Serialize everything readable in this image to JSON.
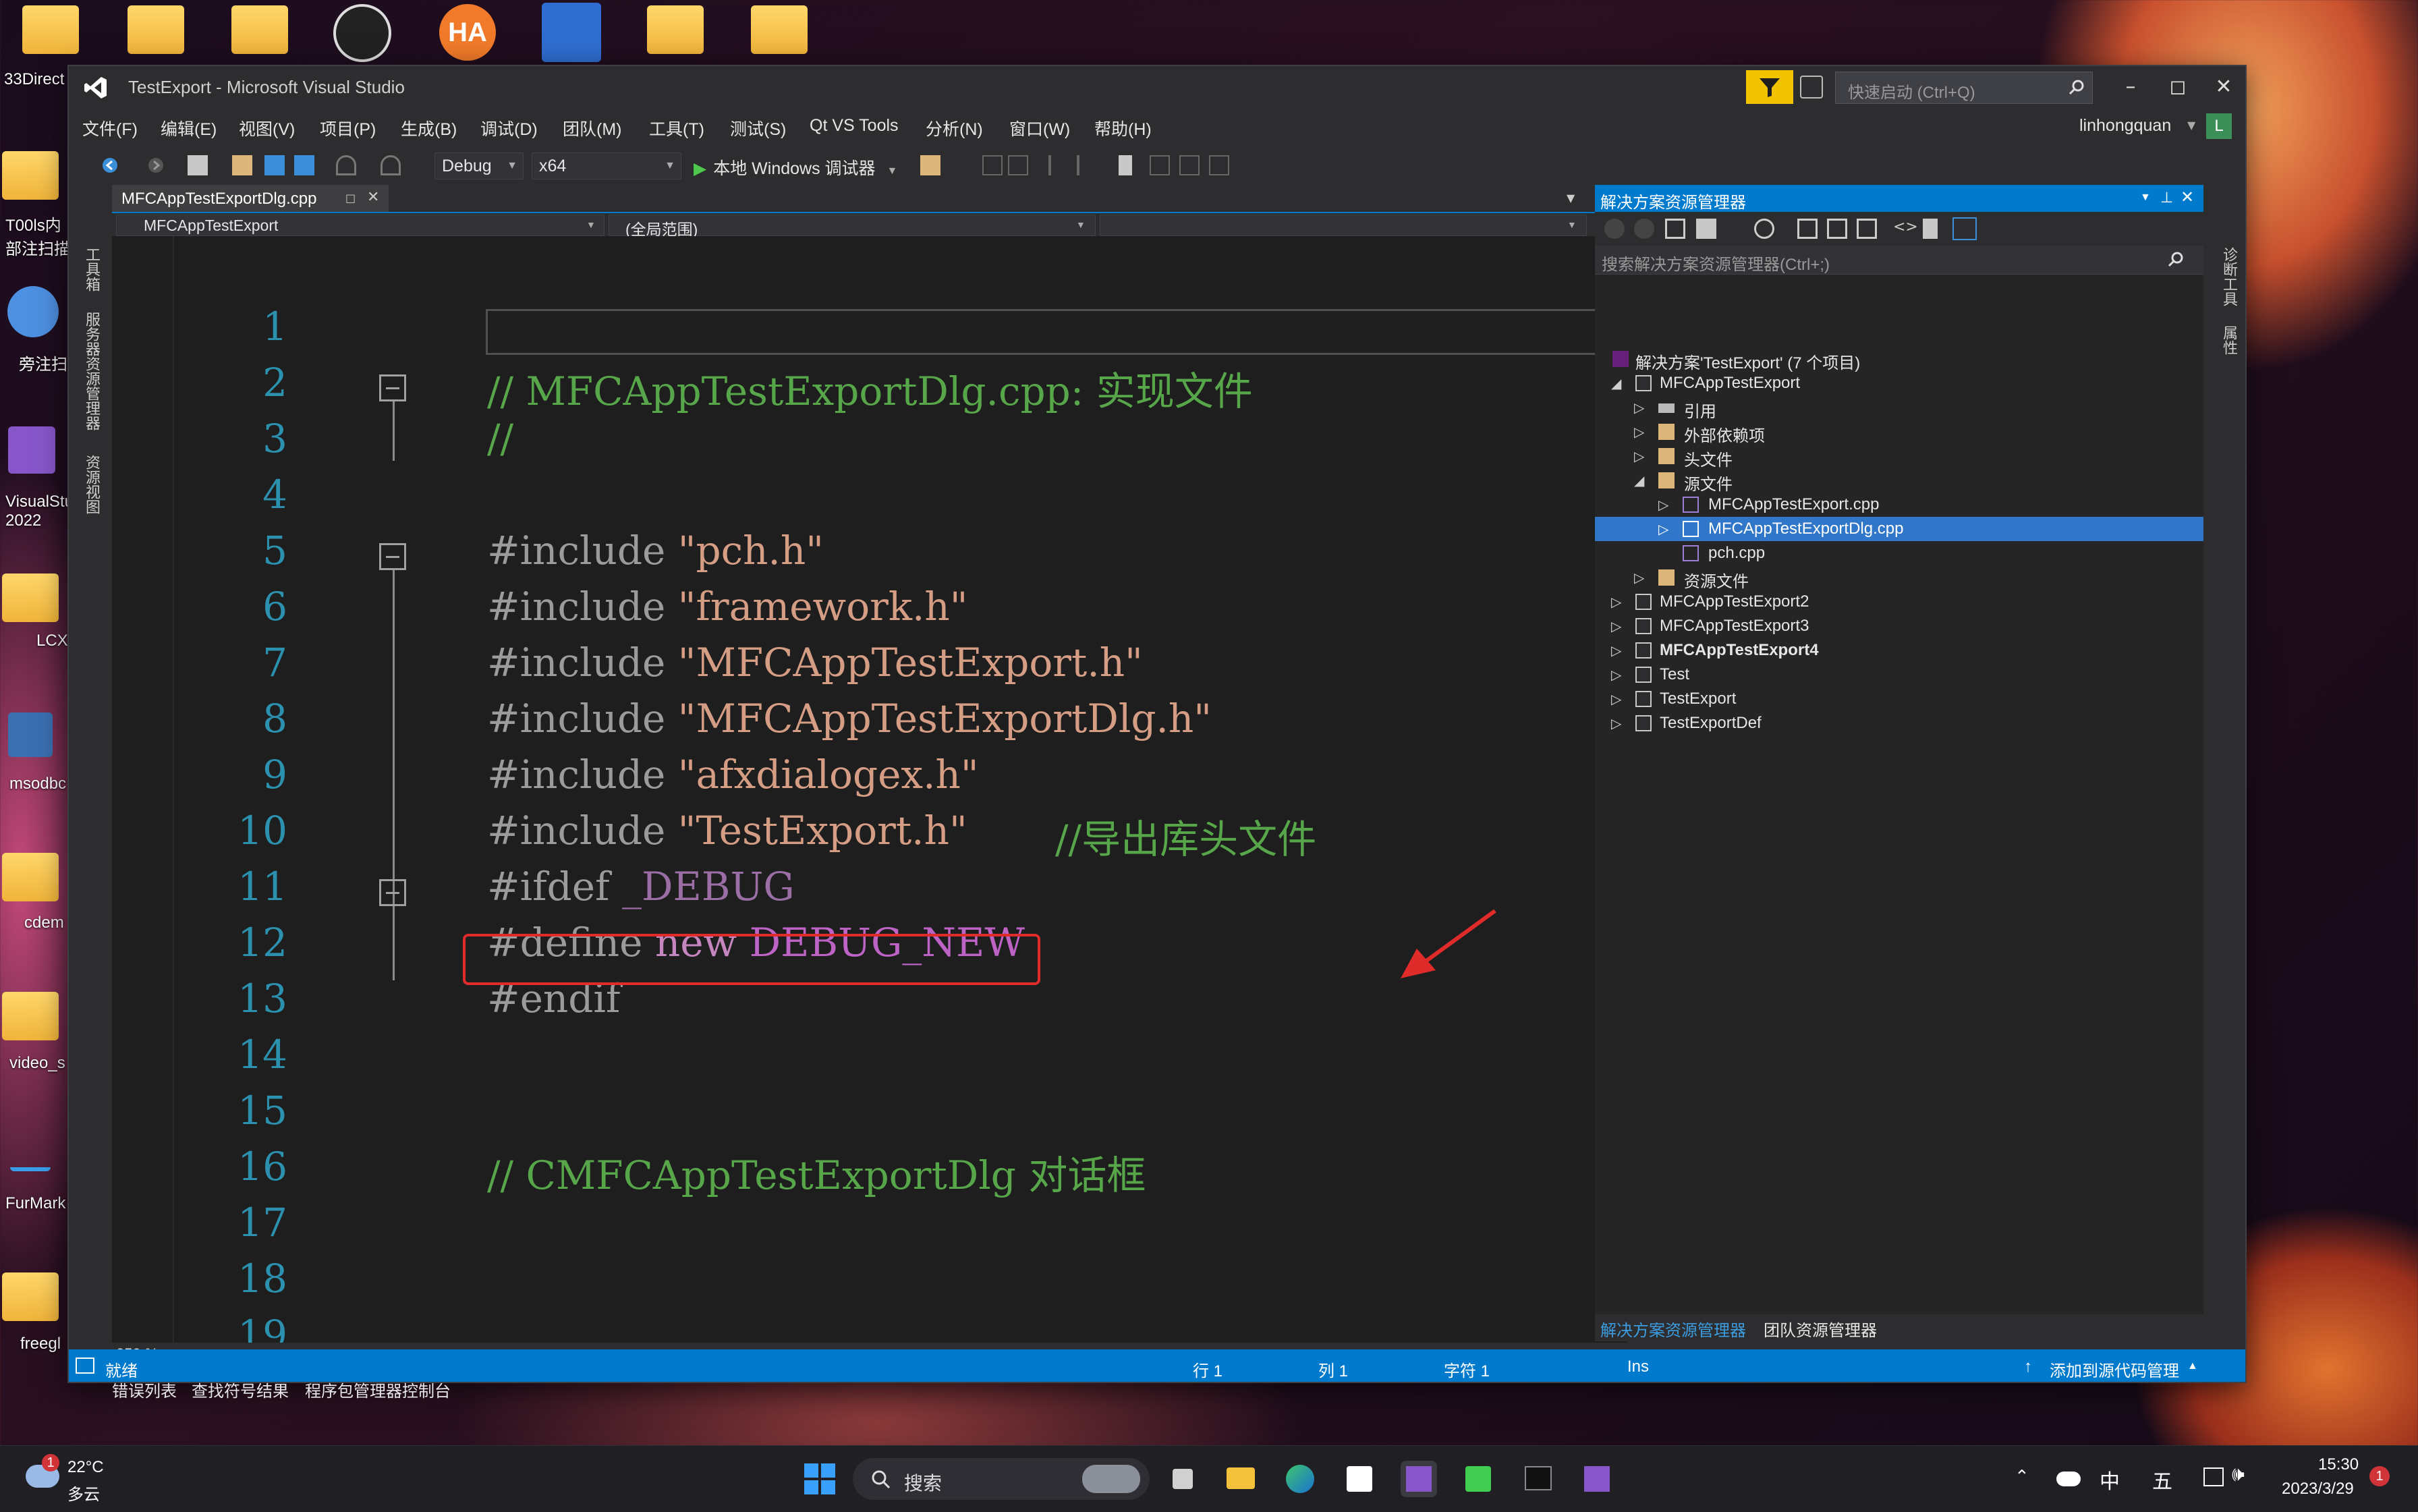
{
  "desktop": {
    "icons": [
      {
        "label": "33Direct"
      },
      {
        "label": "T00ls内部注扫描"
      },
      {
        "label": "旁注扫"
      },
      {
        "label": "VisualStu 2022"
      },
      {
        "label": "LCX"
      },
      {
        "label": "msodbc"
      },
      {
        "label": "cdem"
      },
      {
        "label": "video_s"
      },
      {
        "label": "FurMark"
      },
      {
        "label": "freegl"
      }
    ]
  },
  "window": {
    "title": "TestExport - Microsoft Visual Studio",
    "quick_launch_placeholder": "快速启动 (Ctrl+Q)",
    "user": "linhongquan",
    "user_initial": "L"
  },
  "menu": [
    "文件(F)",
    "编辑(E)",
    "视图(V)",
    "项目(P)",
    "生成(B)",
    "调试(D)",
    "团队(M)",
    "工具(T)",
    "测试(S)",
    "Qt VS Tools",
    "分析(N)",
    "窗口(W)",
    "帮助(H)"
  ],
  "toolbar": {
    "config": "Debug",
    "platform": "x64",
    "run_label": "本地 Windows 调试器"
  },
  "left_strip": [
    "工具箱",
    "服务器资源管理器",
    "资源视图"
  ],
  "right_strip": [
    "诊断工具",
    "属性"
  ],
  "editor": {
    "tab_name": "MFCAppTestExportDlg.cpp",
    "nav_project": "MFCAppTestExport",
    "nav_scope": "(全局范围)",
    "zoom": "259 %",
    "line_numbers": [
      "1",
      "2",
      "3",
      "4",
      "5",
      "6",
      "7",
      "8",
      "9",
      "10",
      "11",
      "12",
      "13",
      "14",
      "15",
      "16",
      "17",
      "18",
      "19"
    ],
    "lines": {
      "l2": "// MFCAppTestExportDlg.cpp: 实现文件",
      "l3": "//",
      "inc": "#include ",
      "l5s": "\"pch.h\"",
      "l6s": "\"framework.h\"",
      "l7s": "\"MFCAppTestExport.h\"",
      "l8s": "\"MFCAppTestExportDlg.h\"",
      "l9s": "\"afxdialogex.h\"",
      "l10s": "\"TestExport.h\"",
      "l10c": "//导出库头文件",
      "l11a": "#ifdef ",
      "l11b": "_DEBUG",
      "l12a": "#define ",
      "l12b": "new",
      "l12c": " DEBUG_NEW",
      "l13": "#endif",
      "l16": "// CMFCAppTestExportDlg 对话框"
    }
  },
  "bottom_tabs": [
    "错误列表",
    "查找符号结果",
    "程序包管理器控制台"
  ],
  "status": {
    "ready": "就绪",
    "row": "行 1",
    "col": "列 1",
    "char": "字符 1",
    "ins": "Ins",
    "source_control": "添加到源代码管理"
  },
  "solution_explorer": {
    "title": "解决方案资源管理器",
    "search_placeholder": "搜索解决方案资源管理器(Ctrl+;)",
    "tabs": [
      "解决方案资源管理器",
      "团队资源管理器"
    ],
    "tree": [
      {
        "label": "解决方案'TestExport' (7 个项目)",
        "icon": "solution-icon",
        "expander": ""
      },
      {
        "label": "MFCAppTestExport",
        "icon": "project-icon",
        "expander": "◢"
      },
      {
        "label": "引用",
        "icon": "reference-icon",
        "expander": "▷"
      },
      {
        "label": "外部依赖项",
        "icon": "folder-icon",
        "expander": "▷"
      },
      {
        "label": "头文件",
        "icon": "folder-icon",
        "expander": "▷"
      },
      {
        "label": "源文件",
        "icon": "folder-icon",
        "expander": "◢"
      },
      {
        "label": "MFCAppTestExport.cpp",
        "icon": "cpp-file-icon",
        "expander": "▷"
      },
      {
        "label": "MFCAppTestExportDlg.cpp",
        "icon": "cpp-file-icon",
        "expander": "▷"
      },
      {
        "label": "pch.cpp",
        "icon": "cpp-file-icon",
        "expander": ""
      },
      {
        "label": "资源文件",
        "icon": "folder-icon",
        "expander": "▷"
      },
      {
        "label": "MFCAppTestExport2",
        "icon": "project-icon",
        "expander": "▷"
      },
      {
        "label": "MFCAppTestExport3",
        "icon": "project-icon",
        "expander": "▷"
      },
      {
        "label": "MFCAppTestExport4",
        "icon": "project-icon",
        "expander": "▷"
      },
      {
        "label": "Test",
        "icon": "project-icon",
        "expander": "▷"
      },
      {
        "label": "TestExport",
        "icon": "project-icon",
        "expander": "▷"
      },
      {
        "label": "TestExportDef",
        "icon": "project-icon",
        "expander": "▷"
      }
    ]
  },
  "taskbar": {
    "weather_temp": "22°C",
    "weather_desc": "多云",
    "weather_badge": "1",
    "search_label": "搜索",
    "ime_lang": "中",
    "ime_mode": "五",
    "time": "15:30",
    "date": "2023/3/29",
    "notification_count": "1"
  },
  "colors": {
    "accent": "#007acc",
    "selection": "#3076c9",
    "highlight_border": "#e02b2b",
    "comment": "#57a64a",
    "string": "#d69d85",
    "line_number": "#2b91af"
  }
}
